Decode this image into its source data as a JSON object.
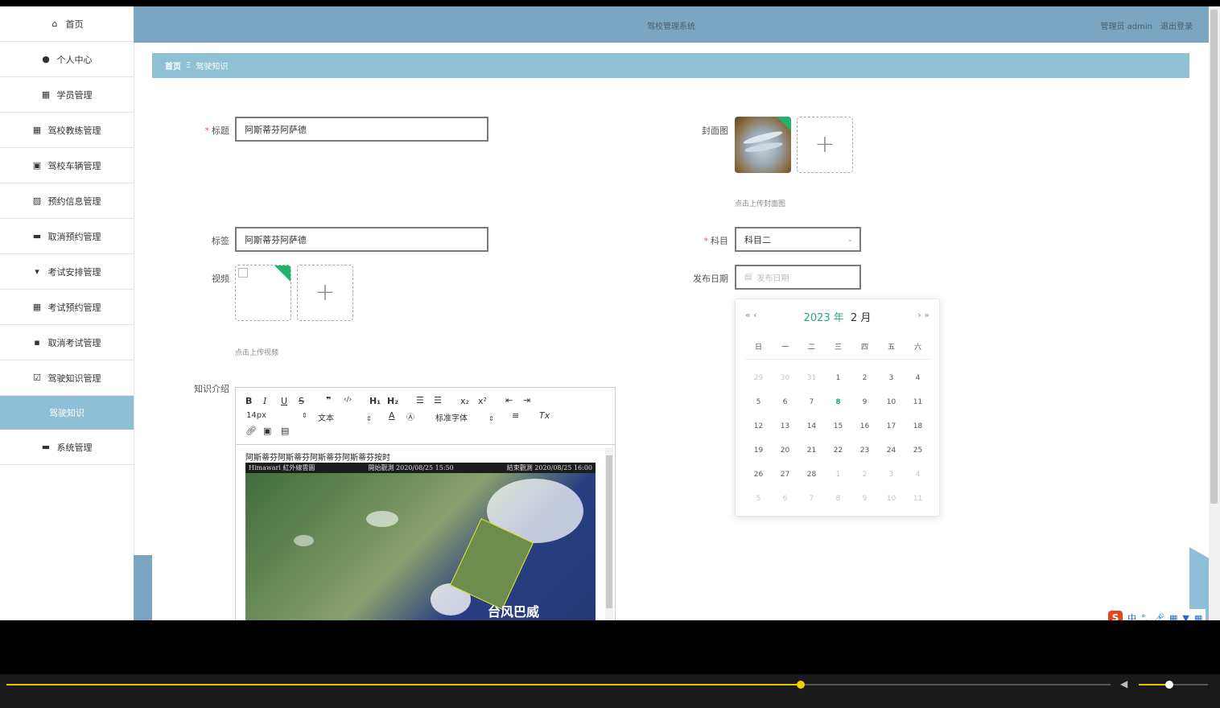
{
  "sidebar": {
    "items": [
      {
        "label": "首页",
        "icon": "home-icon"
      },
      {
        "label": "个人中心",
        "icon": "user-icon"
      },
      {
        "label": "学员管理",
        "icon": "grid-icon"
      },
      {
        "label": "驾校教练管理",
        "icon": "apps-icon"
      },
      {
        "label": "驾校车辆管理",
        "icon": "car-icon"
      },
      {
        "label": "预约信息管理",
        "icon": "chart-icon"
      },
      {
        "label": "取消预约管理",
        "icon": "wallet-icon"
      },
      {
        "label": "考试安排管理",
        "icon": "signpost-icon"
      },
      {
        "label": "考试预约管理",
        "icon": "grid-icon"
      },
      {
        "label": "取消考试管理",
        "icon": "message-icon"
      },
      {
        "label": "驾驶知识管理",
        "icon": "clipboard-icon"
      }
    ],
    "active": "驾驶知识",
    "system": "系统管理"
  },
  "header": {
    "title": "驾校管理系统",
    "user": "管理员 admin",
    "logout": "退出登录"
  },
  "breadcrumb": {
    "home": "首页",
    "sep": "Ξ",
    "current": "驾驶知识"
  },
  "form": {
    "title_label": "标题",
    "title_value": "阿斯蒂芬阿萨德",
    "tag_label": "标签",
    "tag_value": "阿斯蒂芬阿萨德",
    "video_label": "视频",
    "video_hint": "点击上传视频",
    "cover_label": "封面图",
    "cover_hint": "点击上传封面图",
    "subject_label": "科目",
    "subject_value": "科目二",
    "date_label": "发布日期",
    "date_placeholder": "发布日期",
    "intro_label": "知识介绍"
  },
  "editor": {
    "font_size": "14px",
    "text_style": "文本",
    "font_family": "标准字体",
    "content_text": "阿斯蒂芬阿斯蒂芬阿斯蒂芬阿斯蒂芬按时",
    "image_header_left": "Himawari 紅外線雲圖",
    "image_header_mid": "開始觀測 2020/08/25 15:50",
    "image_header_right": "結束觀測 2020/08/25 16:00",
    "image_caption": "台风巴威"
  },
  "datepicker": {
    "year": "2023 年",
    "month": "2 月",
    "weekdays": [
      "日",
      "一",
      "二",
      "三",
      "四",
      "五",
      "六"
    ],
    "weeks": [
      [
        "29",
        "30",
        "31",
        "1",
        "2",
        "3",
        "4"
      ],
      [
        "5",
        "6",
        "7",
        "8",
        "9",
        "10",
        "11"
      ],
      [
        "12",
        "13",
        "14",
        "15",
        "16",
        "17",
        "18"
      ],
      [
        "19",
        "20",
        "21",
        "22",
        "23",
        "24",
        "25"
      ],
      [
        "26",
        "27",
        "28",
        "1",
        "2",
        "3",
        "4"
      ],
      [
        "5",
        "6",
        "7",
        "8",
        "9",
        "10",
        "11"
      ]
    ],
    "today": "8"
  },
  "ime": {
    "lang": "中"
  },
  "colors": {
    "header": "#7aa6c4",
    "breadcrumb": "#8fc0d5",
    "active_nav": "#8fbfd6",
    "accent": "#2aa58a"
  }
}
